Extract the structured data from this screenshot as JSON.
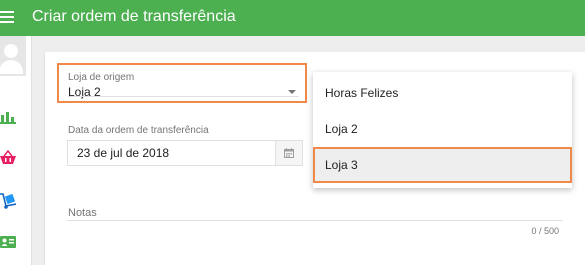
{
  "header": {
    "title": "Criar ordem de transferência",
    "color": "#4caf50"
  },
  "sidebar": {
    "items": [
      {
        "icon": "bar-chart-icon",
        "color": "#4caf50"
      },
      {
        "icon": "shopping-basket-icon",
        "color": "#e91e63"
      },
      {
        "icon": "hand-truck-icon",
        "color": "#2196f3"
      },
      {
        "icon": "id-card-icon",
        "color": "#4caf50"
      }
    ]
  },
  "form": {
    "origin_label": "Loja de origem",
    "origin_value": "Loja 2",
    "date_label": "Data da ordem de transferência",
    "date_value": "23 de jul de 2018",
    "notes_label": "Notas",
    "notes_count": "0 / 500"
  },
  "dropdown": {
    "options": [
      "Horas Felizes",
      "Loja 2",
      "Loja 3"
    ],
    "highlighted": "Loja 3"
  },
  "highlight_color": "#f0894a"
}
